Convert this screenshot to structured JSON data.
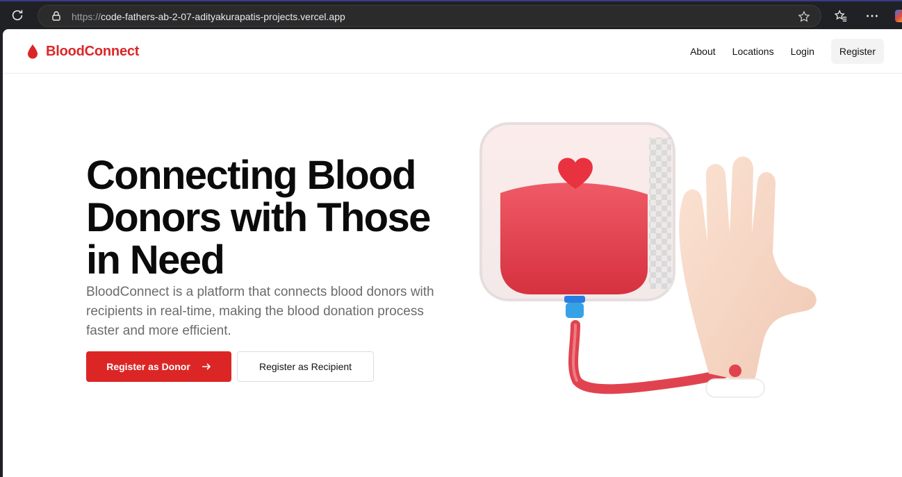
{
  "browser": {
    "url_protocol": "https://",
    "url_host": "code-fathers-ab-2-07-adityakurapatis-projects.vercel.app"
  },
  "nav": {
    "brand": "BloodConnect",
    "links": [
      "About",
      "Locations",
      "Login"
    ],
    "register": "Register"
  },
  "hero": {
    "title": "Connecting Blood Donors with Those in Need",
    "description": "BloodConnect is a platform that connects blood donors with recipients in real-time, making the blood donation process faster and more efficient.",
    "donor_button": "Register as Donor",
    "recipient_button": "Register as Recipient"
  },
  "colors": {
    "brand": "#dc2626",
    "text": "#0b0b0b",
    "muted": "#6b6b6b"
  },
  "icons": {
    "reload": "reload-icon",
    "lock": "lock-icon",
    "favorite": "star-icon",
    "favorites_bar": "favorites-icon",
    "more": "more-icon",
    "brand": "blood-drop-icon",
    "arrow": "arrow-right-icon"
  }
}
